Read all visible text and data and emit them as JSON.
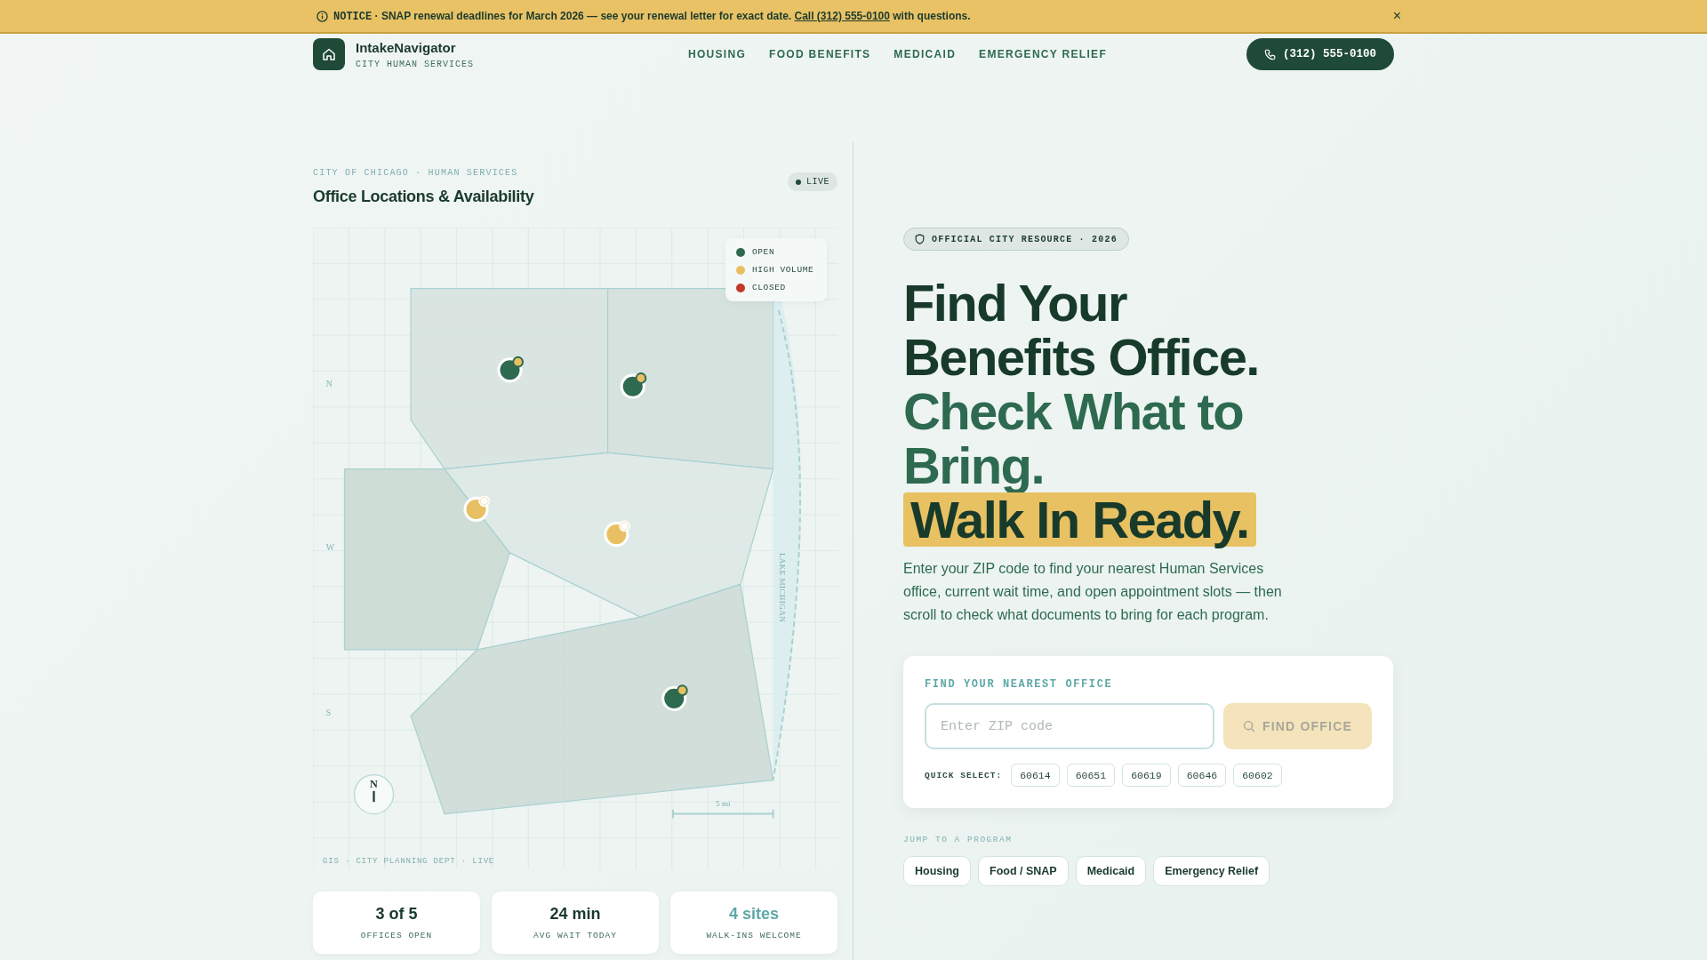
{
  "notice": {
    "label": "NOTICE",
    "text": "· SNAP renewal deadlines for March 2026 — see your renewal letter for exact date.",
    "link": "Call (312) 555-0100",
    "after": "with questions.",
    "close": "×"
  },
  "header": {
    "brand": "IntakeNavigator",
    "subtitle": "CITY HUMAN SERVICES",
    "nav": [
      "HOUSING",
      "FOOD BENEFITS",
      "MEDICAID",
      "EMERGENCY RELIEF"
    ],
    "phone": "(312) 555-0100"
  },
  "map_panel": {
    "eyebrow": "CITY OF CHICAGO · HUMAN SERVICES",
    "title": "Office Locations & Availability",
    "live": "LIVE",
    "legend": [
      {
        "label": "OPEN",
        "kind": "open",
        "color": "#2d6a4f"
      },
      {
        "label": "HIGH VOLUME",
        "kind": "high",
        "color": "#e8bf62"
      },
      {
        "label": "CLOSED",
        "kind": "closed",
        "color": "#c0392b"
      }
    ],
    "pins": [
      {
        "kind": "open"
      },
      {
        "kind": "open"
      },
      {
        "kind": "high"
      },
      {
        "kind": "high"
      },
      {
        "kind": "open"
      }
    ],
    "edge_labels": [
      "N",
      "W",
      "S"
    ],
    "lake": "LAKE MICHIGAN",
    "compass": "N",
    "scale": "5 mi",
    "source": "GIS · CITY PLANNING DEPT · LIVE"
  },
  "stats": [
    {
      "value": "3 of 5",
      "label": "OFFICES OPEN",
      "accent": false
    },
    {
      "value": "24 min",
      "label": "AVG WAIT TODAY",
      "accent": false
    },
    {
      "value": "4 sites",
      "label": "WALK-INS WELCOME",
      "accent": true
    }
  ],
  "hero": {
    "badge": "OFFICIAL CITY RESOURCE · 2026",
    "headline": [
      {
        "text": "Find Your Benefits Office.",
        "kind": "dark"
      },
      {
        "text": "Check What to Bring.",
        "kind": "accent"
      },
      {
        "text": "Walk In Ready.",
        "kind": "highlight"
      }
    ],
    "intro": "Enter your ZIP code to find your nearest Human Services office, current wait time, and open appointment slots — then scroll to check what documents to bring for each program."
  },
  "search": {
    "title": "FIND YOUR NEAREST OFFICE",
    "placeholder": "Enter ZIP code",
    "button": "FIND OFFICE",
    "disabled": true,
    "quick_label": "QUICK SELECT:",
    "zips": [
      "60614",
      "60651",
      "60619",
      "60646",
      "60602"
    ]
  },
  "programs": {
    "label": "JUMP TO A PROGRAM",
    "items": [
      "Housing",
      "Food / SNAP",
      "Medicaid",
      "Emergency Relief"
    ]
  }
}
